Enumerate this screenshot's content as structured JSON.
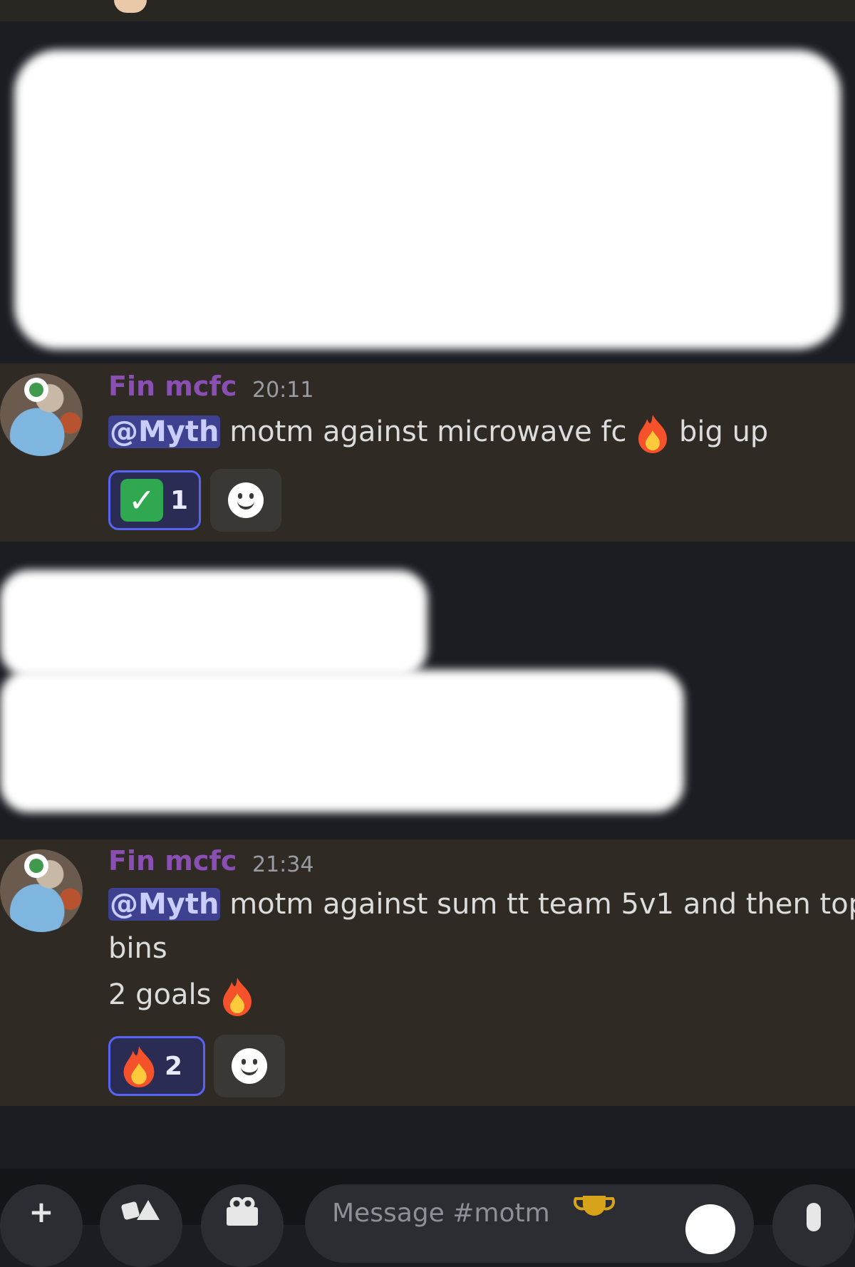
{
  "messages": [
    {
      "author": "Fin mcfc",
      "time": "20:11",
      "mention": "@Myth",
      "lines": [
        "motm against microwave fc",
        "big up"
      ],
      "reaction": {
        "emoji": "check-mark",
        "count": "1"
      }
    },
    {
      "author": "Fin mcfc",
      "time": "21:34",
      "mention": "@Myth",
      "lines": [
        "motm against sum tt team 5v1 and then top",
        "bins",
        "2 goals"
      ],
      "reaction": {
        "emoji": "fire",
        "count": "2"
      }
    }
  ],
  "composer": {
    "placeholder": "Message #motm"
  },
  "icons": [
    "plus-icon",
    "apps-icon",
    "gift-icon",
    "trophy-icon",
    "emoji-icon",
    "microphone-icon",
    "fire-emoji",
    "check-mark-emoji",
    "add-reaction-icon"
  ],
  "colors": {
    "background": "#1c1d23",
    "message_highlight": "#302a25",
    "author": "#8a4fb3",
    "mention_bg": "#3d4190",
    "reaction_border": "#5865f2"
  }
}
